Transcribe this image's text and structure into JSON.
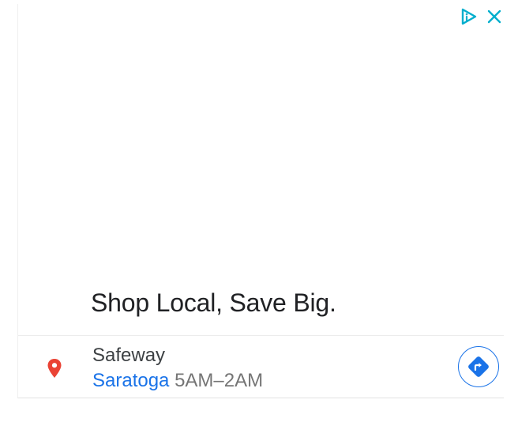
{
  "ad": {
    "headline": "Shop Local, Save Big.",
    "icons": {
      "ad_choices": "adchoices-icon",
      "close": "close-icon",
      "pin": "map-pin-icon",
      "directions": "directions-icon"
    }
  },
  "location": {
    "store_name": "Safeway",
    "city": "Saratoga",
    "hours": "5AM–2AM"
  },
  "colors": {
    "accent": "#1a73e8",
    "pin": "#ea4335",
    "text_dark": "#202124",
    "text_muted": "#757575"
  }
}
